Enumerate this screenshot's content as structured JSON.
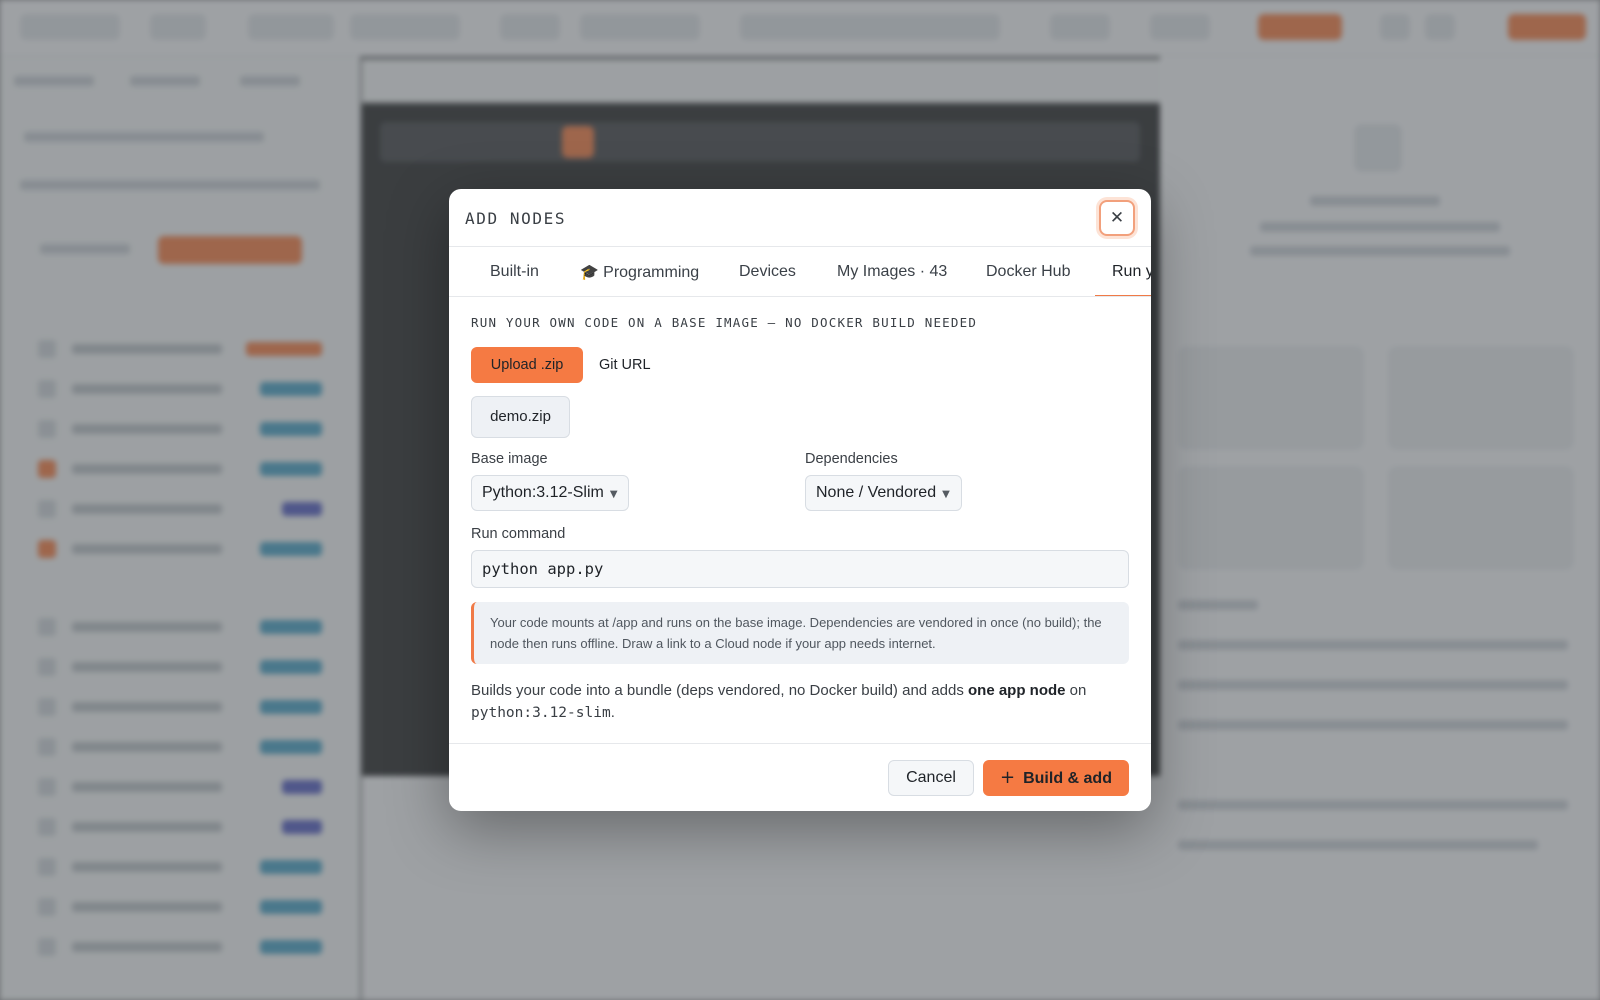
{
  "modal": {
    "title": "ADD NODES",
    "close_icon": "close-icon",
    "tabs": [
      {
        "label": "Built-in"
      },
      {
        "label": "Programming",
        "icon": "graduation-cap-icon",
        "icon_glyph": "🎓"
      },
      {
        "label": "Devices"
      },
      {
        "label": "My Images · 43"
      },
      {
        "label": "Docker Hub"
      },
      {
        "label": "Run y",
        "active": true
      }
    ],
    "section_heading": "RUN YOUR OWN CODE ON A BASE IMAGE — NO DOCKER BUILD NEEDED",
    "source_options": {
      "upload": "Upload .zip",
      "git": "Git URL"
    },
    "uploaded_file": "demo.zip",
    "base_image": {
      "label": "Base image",
      "value": "Python:3.12-Slim"
    },
    "dependencies": {
      "label": "Dependencies",
      "value": "None / Vendored"
    },
    "run_command": {
      "label": "Run command",
      "value": "python app.py"
    },
    "info": "Your code mounts at /app and runs on the base image. Dependencies are vendored in once (no build); the node then runs offline. Draw a link to a Cloud node if your app needs internet.",
    "summary": {
      "prefix": "Builds your code into a bundle (deps vendored, no Docker build) and adds ",
      "bold": "one app node",
      "middle": " on",
      "code": "python:3.12-slim",
      "suffix": "."
    },
    "buttons": {
      "cancel": "Cancel",
      "build": "Build & add",
      "build_icon": "plus-icon"
    }
  },
  "colors": {
    "accent": "#f57a43",
    "accent_border": "#f07a47"
  }
}
